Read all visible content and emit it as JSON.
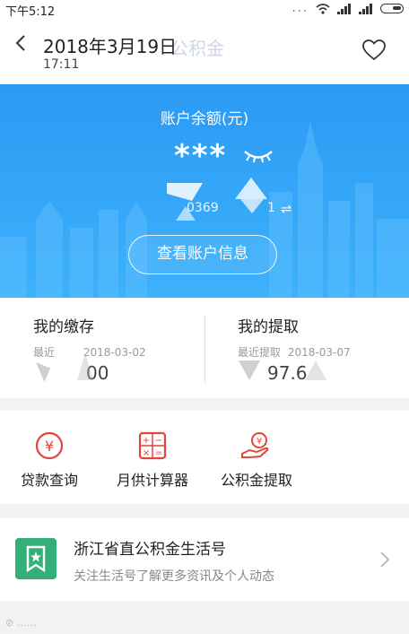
{
  "status_bar": {
    "time": "下午5:12",
    "dots": "..."
  },
  "header": {
    "date": "2018年3月19日",
    "time": "17:11",
    "ghost_title": "公积金"
  },
  "balance": {
    "label": "账户余额(元)",
    "masked_value": "***",
    "account_partial_1": "0369",
    "account_partial_2": "1",
    "view_button": "查看账户信息"
  },
  "summary": {
    "deposit": {
      "title": "我的缴存",
      "recent_label": "最近",
      "date": "2018-03-02",
      "amount_visible": "00"
    },
    "withdraw": {
      "title": "我的提取",
      "recent_label": "最近提取",
      "date": "2018-03-07",
      "amount_visible": "97.6"
    }
  },
  "services": [
    {
      "label": "贷款查询",
      "icon": "yen-circle-icon"
    },
    {
      "label": "月供计算器",
      "icon": "calculator-icon"
    },
    {
      "label": "公积金提取",
      "icon": "hand-money-icon"
    }
  ],
  "subscription": {
    "title": "浙江省直公积金生活号",
    "subtitle": "关注生活号了解更多资讯及个人动态"
  },
  "colors": {
    "banner": "#2b9af4",
    "icon_red": "#e0463a",
    "card_green": "#33b07a"
  }
}
